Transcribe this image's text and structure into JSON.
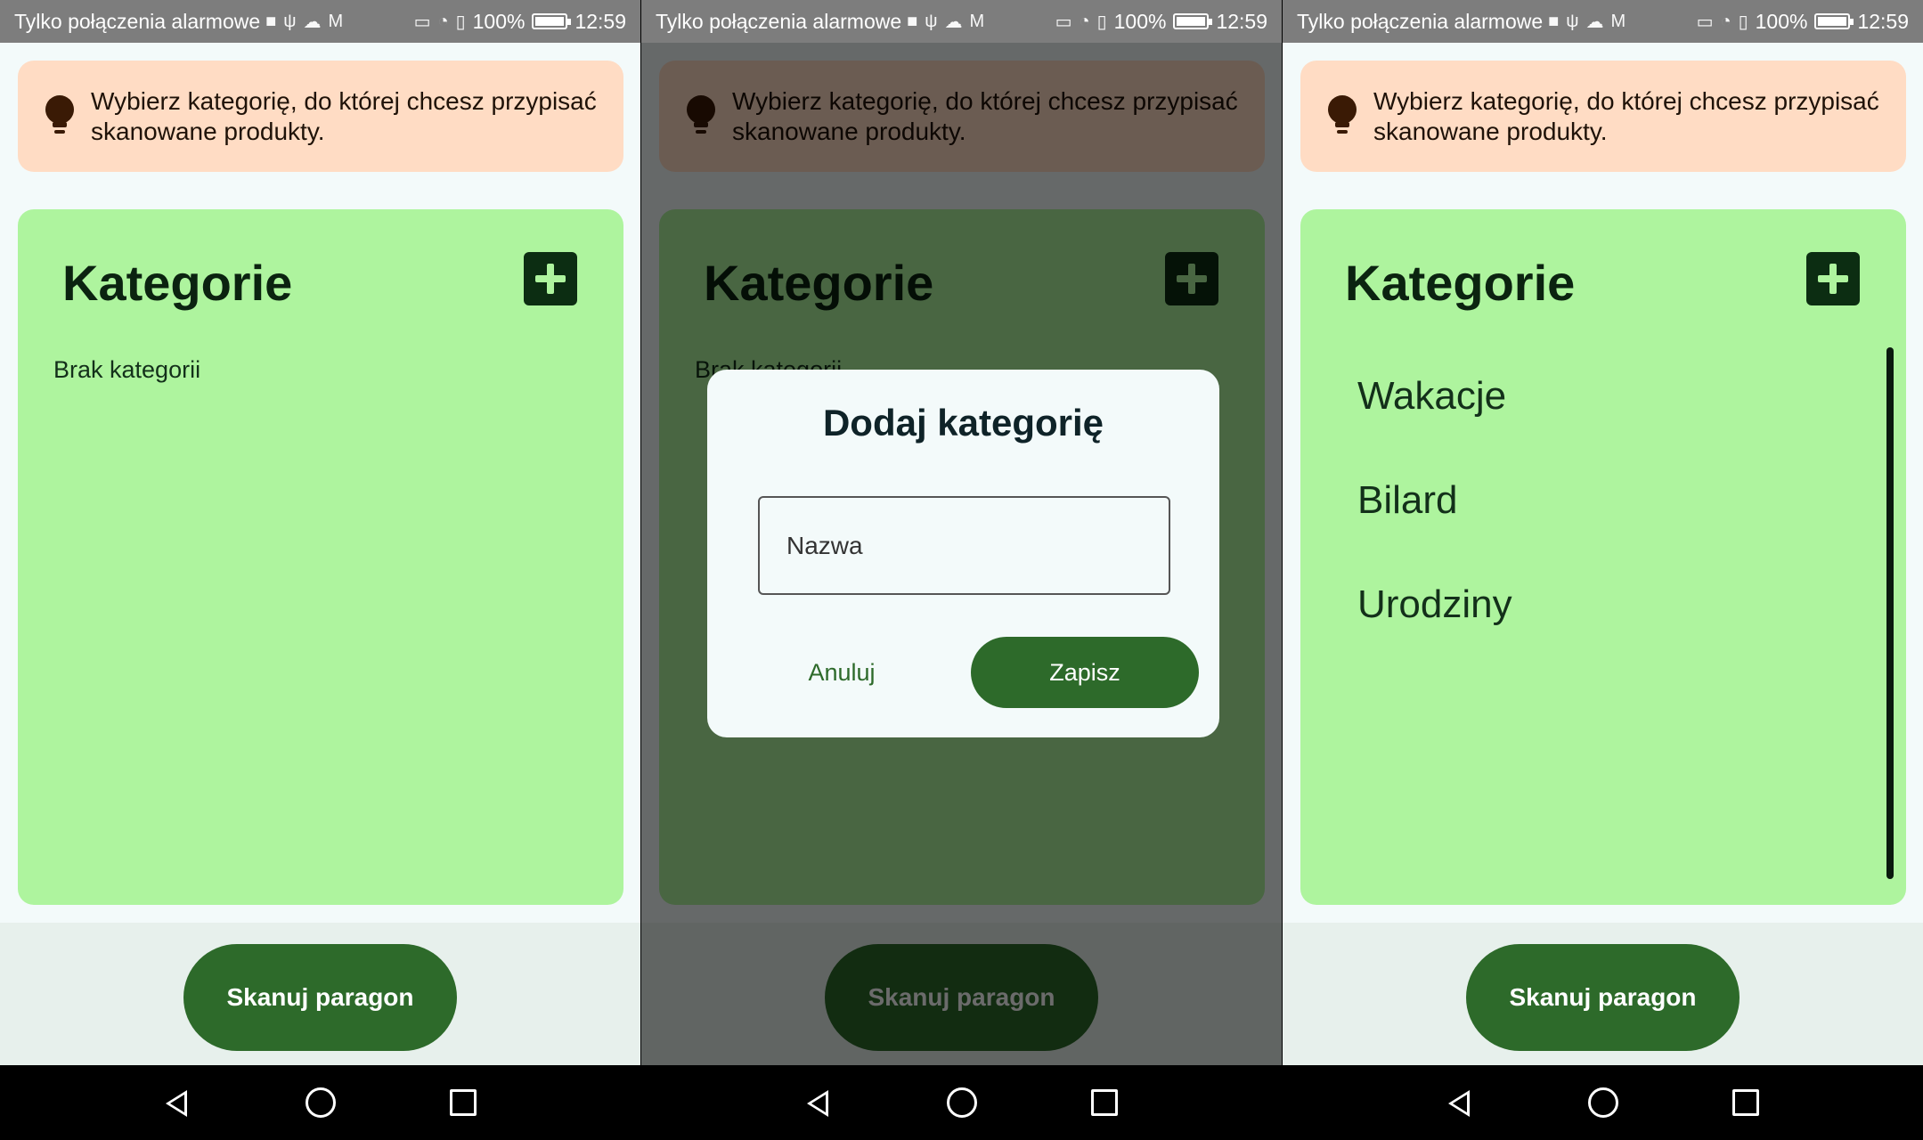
{
  "status_bar": {
    "carrier": "Tylko połączenia alarmowe",
    "battery": "100%",
    "time": "12:59",
    "battery_level": 1.0,
    "icons": [
      "camera-icon",
      "usb-icon",
      "cloud-icon",
      "gmail-icon",
      "cast-icon",
      "wifi-icon",
      "sim-icon"
    ]
  },
  "hint": {
    "text": "Wybierz kategorię, do której chcesz przypisać skanowane produkty.",
    "icon": "lightbulb-icon"
  },
  "categories": {
    "title": "Kategorie",
    "add_icon": "plus-icon",
    "empty_text": "Brak kategorii",
    "items": [
      "Wakacje",
      "Bilard",
      "Urodziny"
    ]
  },
  "scan_button": {
    "label": "Skanuj paragon"
  },
  "dialog": {
    "title": "Dodaj kategorię",
    "name_placeholder": "Nazwa",
    "cancel_label": "Anuluj",
    "save_label": "Zapisz"
  },
  "nav_bar": {
    "icons": [
      "back-icon",
      "home-icon",
      "recent-apps-icon"
    ]
  },
  "colors": {
    "hint_bg": "#ffdcc4",
    "card_bg": "#aef49e",
    "primary": "#2d6a2a",
    "dark_green": "#0c2d12",
    "status_bar": "#7d7d7d"
  }
}
